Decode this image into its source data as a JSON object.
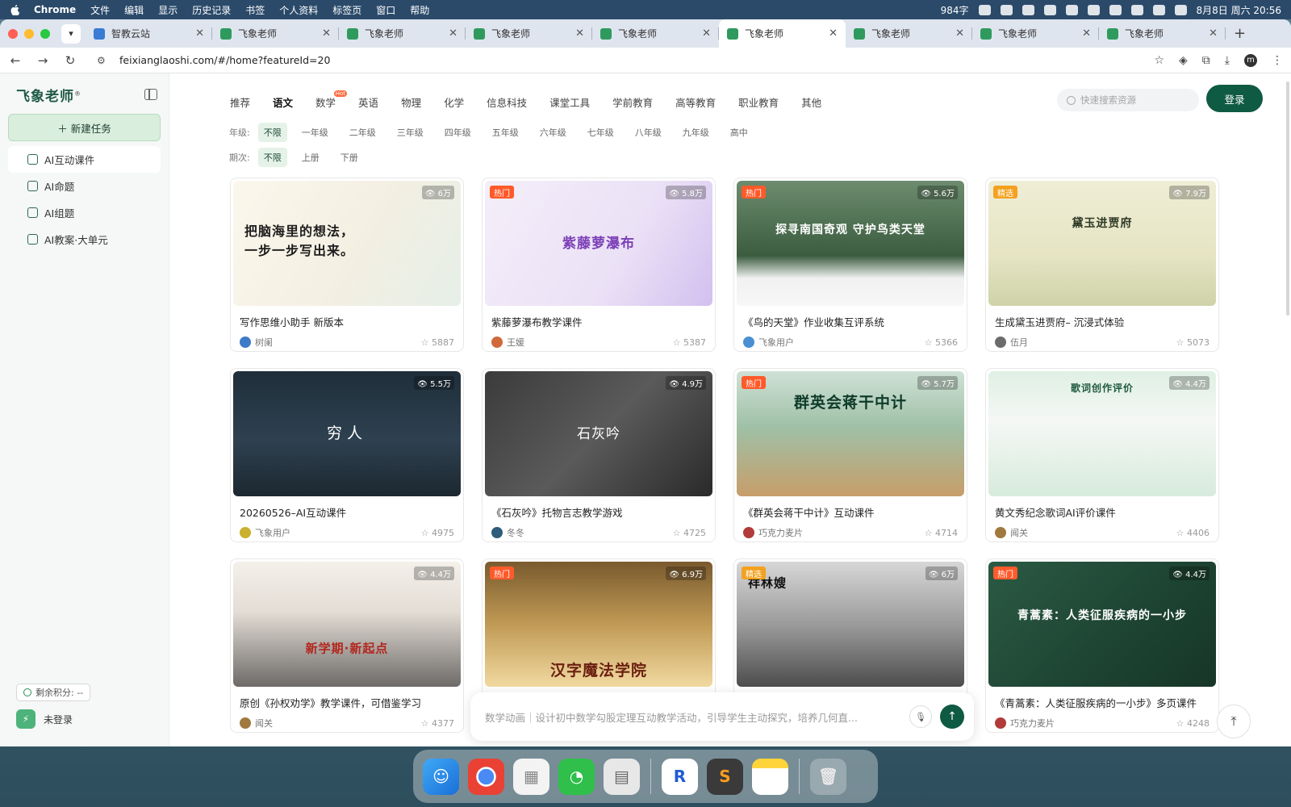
{
  "menubar": {
    "app": "Chrome",
    "items": [
      "文件",
      "编辑",
      "显示",
      "历史记录",
      "书签",
      "个人资料",
      "标签页",
      "窗口",
      "帮助"
    ],
    "word_count": "984字",
    "datetime": "8月8日 周六 20:56"
  },
  "tabs": [
    {
      "title": "智教云站"
    },
    {
      "title": "飞象老师"
    },
    {
      "title": "飞象老师"
    },
    {
      "title": "飞象老师"
    },
    {
      "title": "飞象老师"
    },
    {
      "title": "飞象老师"
    },
    {
      "title": "飞象老师"
    },
    {
      "title": "飞象老师"
    },
    {
      "title": "飞象老师"
    }
  ],
  "address": {
    "url": "feixianglaoshi.com/#/home?featureId=20",
    "profile_initial": "m"
  },
  "sidebar": {
    "logo": "飞象老师",
    "new_task": "＋ 新建任务",
    "items": [
      {
        "label": "AI互动课件"
      },
      {
        "label": "AI命题"
      },
      {
        "label": "AI组题"
      },
      {
        "label": "AI教案·大单元"
      }
    ],
    "credits": "剩余积分: --",
    "login_status": "未登录"
  },
  "categories": [
    "推荐",
    "语文",
    "数学",
    "英语",
    "物理",
    "化学",
    "信息科技",
    "课堂工具",
    "学前教育",
    "高等教育",
    "职业教育",
    "其他"
  ],
  "hot_tag": "Hot",
  "search": {
    "placeholder": "快速搜索资源"
  },
  "login_button": "登录",
  "grade_filter": {
    "label": "年级:",
    "options": [
      "不限",
      "一年级",
      "二年级",
      "三年级",
      "四年级",
      "五年级",
      "六年级",
      "七年级",
      "八年级",
      "九年级",
      "高中"
    ]
  },
  "term_filter": {
    "label": "期次:",
    "options": [
      "不限",
      "上册",
      "下册"
    ]
  },
  "cards": [
    {
      "thumb_text": "把脑海里的想法，一步一步写出来。",
      "badge": "",
      "views": "6万",
      "title": "写作思维小助手 新版本",
      "author": "树阑",
      "favorites": "5887"
    },
    {
      "thumb_text": "紫藤萝瀑布",
      "badge": "热门",
      "views": "5.8万",
      "title": "紫藤萝瀑布教学课件",
      "author": "王媛",
      "favorites": "5387"
    },
    {
      "thumb_text": "探寻南国奇观 守护鸟类天堂",
      "badge": "热门",
      "views": "5.6万",
      "title": "《鸟的天堂》作业收集互评系统",
      "author": "飞象用户",
      "favorites": "5366"
    },
    {
      "thumb_text": "黛玉进贾府",
      "badge": "精选",
      "views": "7.9万",
      "title": "生成黛玉进贾府– 沉浸式体验",
      "author": "伍月",
      "favorites": "5073"
    },
    {
      "thumb_text": "穷人",
      "badge": "",
      "views": "5.5万",
      "title": "20260526–AI互动课件",
      "author": "飞象用户",
      "favorites": "4975"
    },
    {
      "thumb_text": "石灰吟",
      "badge": "",
      "views": "4.9万",
      "title": "《石灰吟》托物言志教学游戏",
      "author": "冬冬",
      "favorites": "4725"
    },
    {
      "thumb_text": "群英会蒋干中计",
      "badge": "热门",
      "views": "5.7万",
      "title": "《群英会蒋干中计》互动课件",
      "author": "巧克力麦片",
      "favorites": "4714"
    },
    {
      "thumb_text": "歌词创作评价",
      "badge": "",
      "views": "4.4万",
      "title": "黄文秀纪念歌词AI评价课件",
      "author": "闻关",
      "favorites": "4406"
    },
    {
      "thumb_text": "新学期·新起点",
      "badge": "",
      "views": "4.4万",
      "title": "原创《孙权劝学》教学课件，可借鉴学习",
      "author": "闻关",
      "favorites": "4377"
    },
    {
      "thumb_text": "汉字魔法学院",
      "badge": "热门",
      "views": "6.9万",
      "title": "",
      "author": "",
      "favorites": ""
    },
    {
      "thumb_text": "祥林嫂",
      "badge": "精选",
      "views": "6万",
      "title": "",
      "author": "",
      "favorites": ""
    },
    {
      "thumb_text": "青蒿素：人类征服疾病的一小步",
      "badge": "热门",
      "views": "4.4万",
      "title": "《青蒿素：人类征服疾病的一小步》多页课件",
      "author": "巧克力麦片",
      "favorites": "4248"
    }
  ],
  "prompt": {
    "placeholder": "数学动画｜设计初中数学勾股定理互动教学活动，引导学生主动探究，培养几何直..."
  },
  "colors": {
    "brand": "#0f5a43",
    "hot": "#ff5a2a",
    "pick": "#f4a11f"
  }
}
